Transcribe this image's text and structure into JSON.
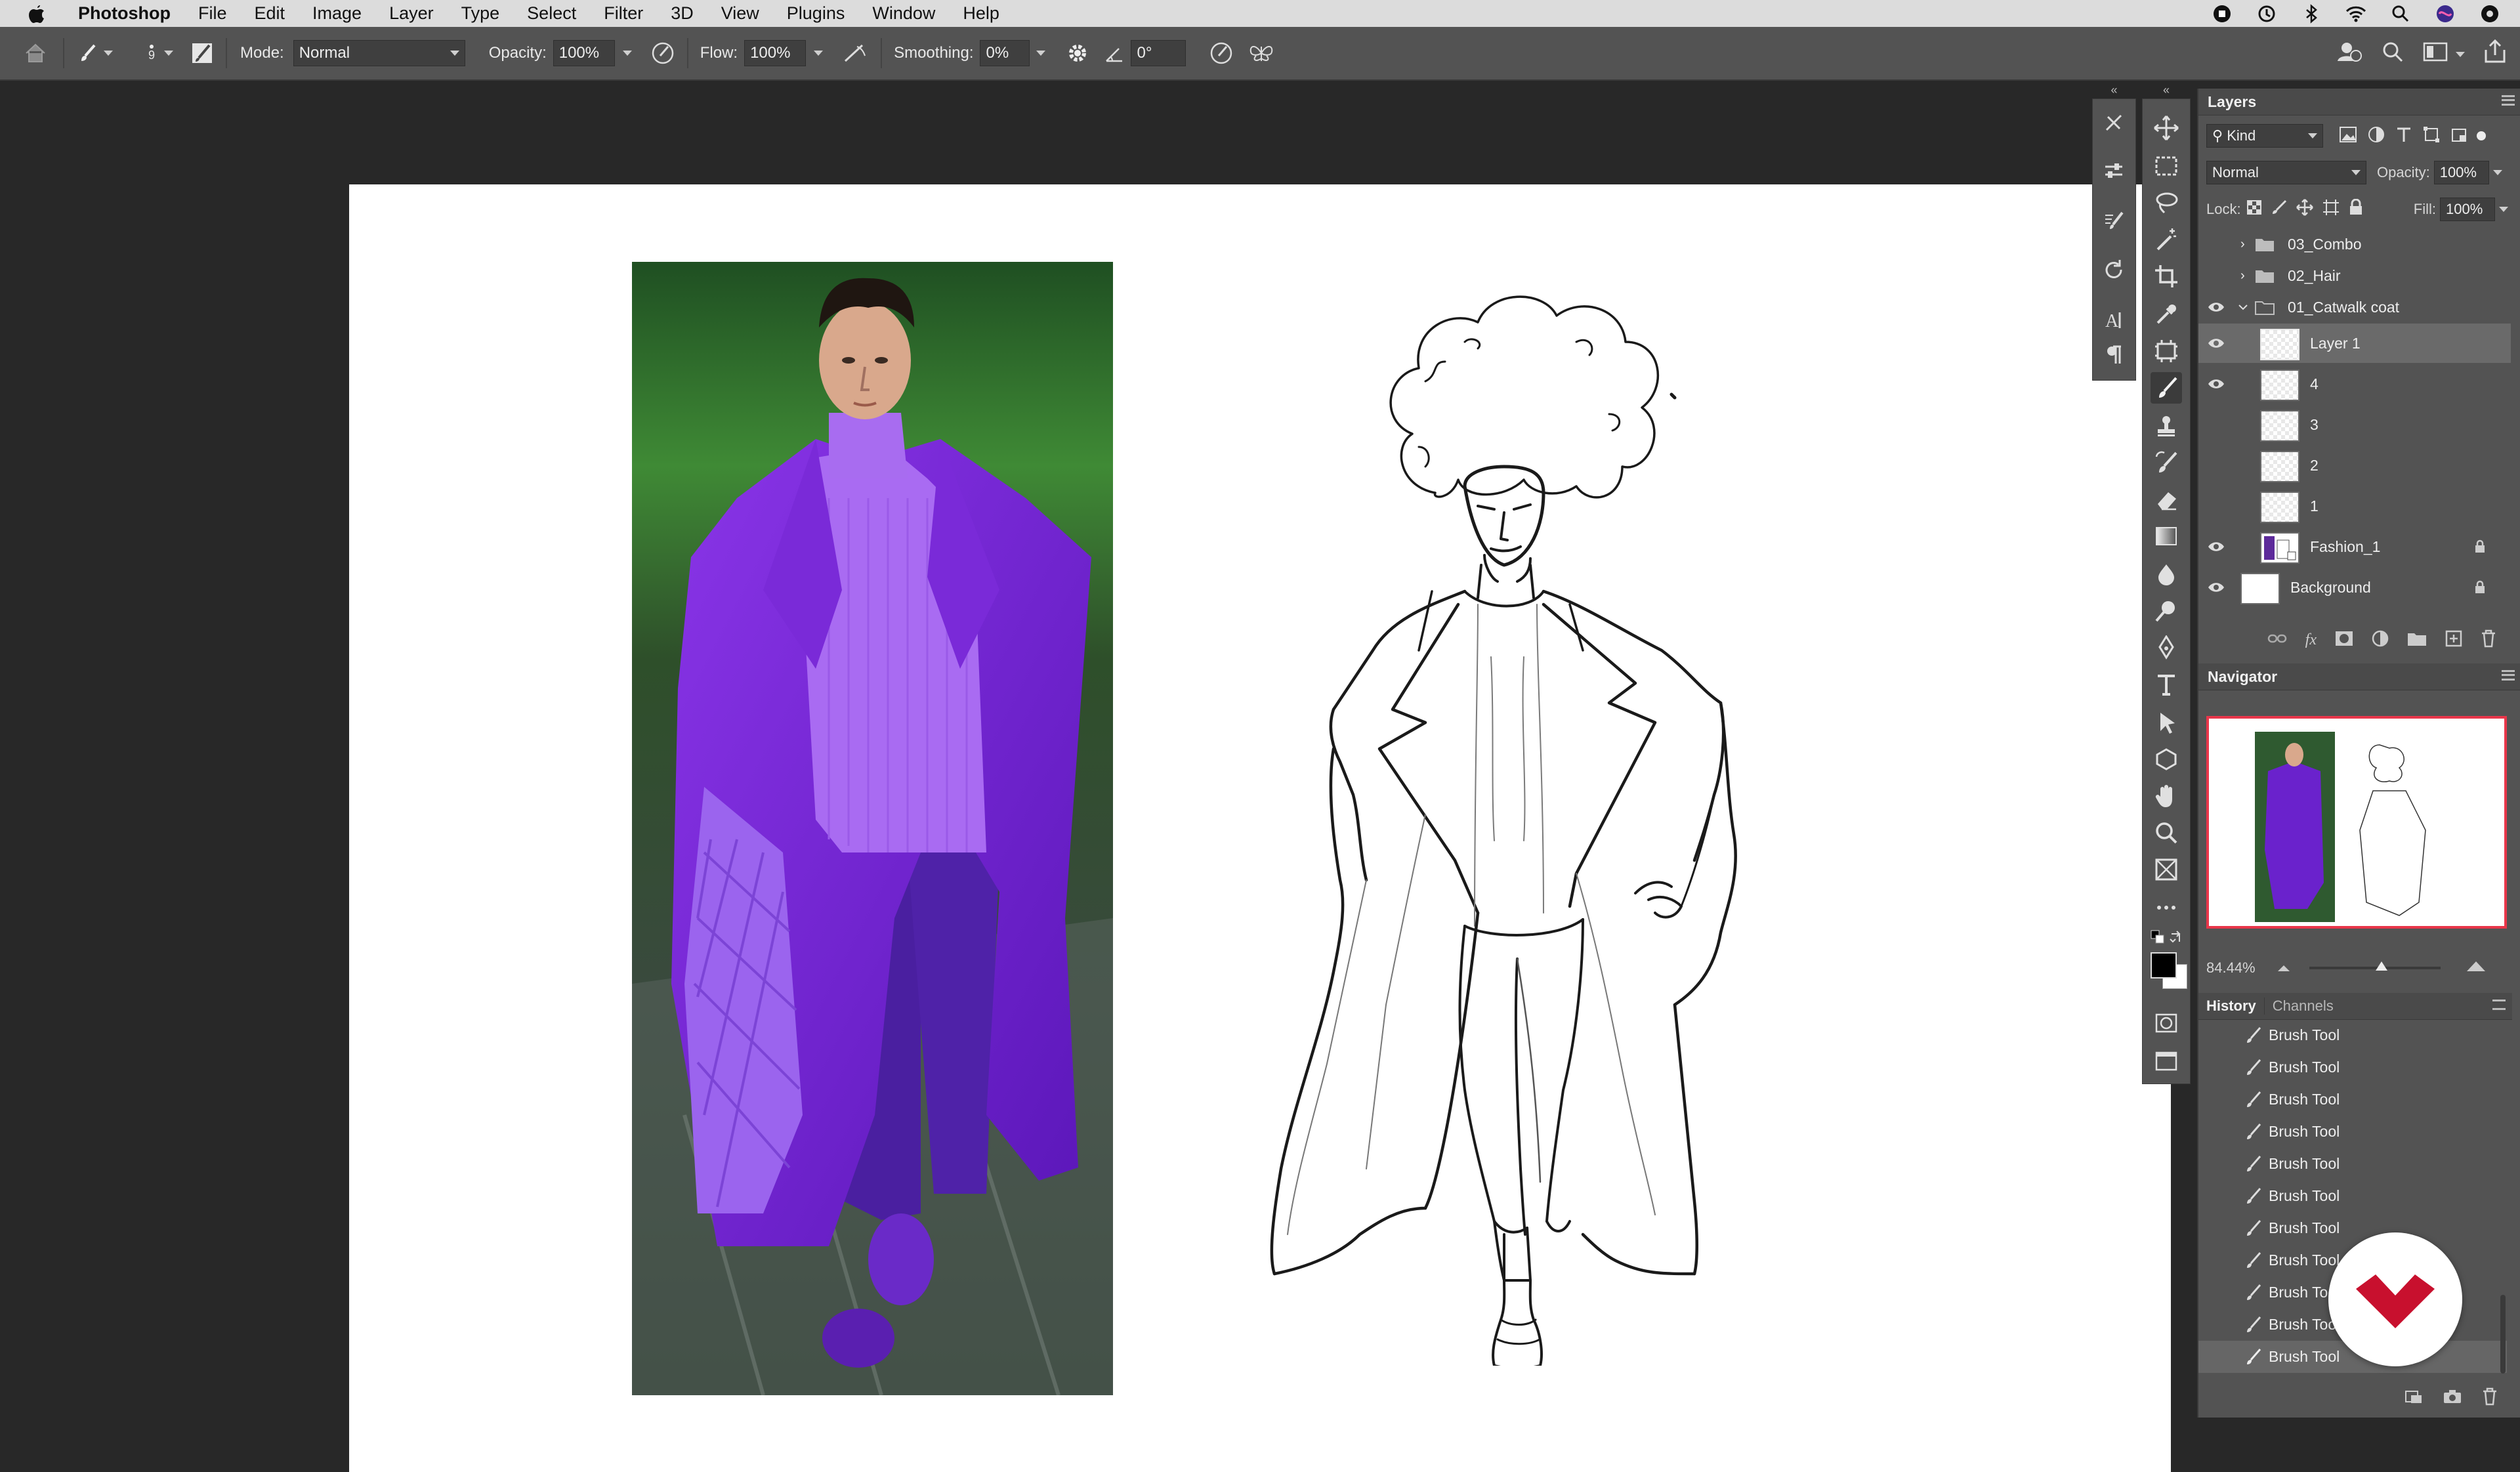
{
  "menubar": {
    "app": "Photoshop",
    "items": [
      "File",
      "Edit",
      "Image",
      "Layer",
      "Type",
      "Select",
      "Filter",
      "3D",
      "View",
      "Plugins",
      "Window",
      "Help"
    ],
    "right_icons": [
      "record-icon",
      "time-machine-icon",
      "bluetooth-icon",
      "wifi-icon",
      "search-icon",
      "siri-icon",
      "control-center-icon"
    ]
  },
  "options": {
    "brush_size": "9",
    "mode_label": "Mode:",
    "mode_value": "Normal",
    "opacity_label": "Opacity:",
    "opacity_value": "100%",
    "flow_label": "Flow:",
    "flow_value": "100%",
    "smoothing_label": "Smoothing:",
    "smoothing_value": "0%",
    "angle_value": "0°"
  },
  "layers_panel": {
    "title": "Layers",
    "kind_label": "Kind",
    "blend_mode": "Normal",
    "opacity_label": "Opacity:",
    "opacity_value": "100%",
    "lock_label": "Lock:",
    "fill_label": "Fill:",
    "fill_value": "100%",
    "items": [
      {
        "name": "03_Combo",
        "type": "group",
        "visible": false,
        "expanded": false
      },
      {
        "name": "02_Hair",
        "type": "group",
        "visible": false,
        "expanded": false
      },
      {
        "name": "01_Catwalk coat",
        "type": "group",
        "visible": true,
        "expanded": true
      },
      {
        "name": "Layer 1",
        "type": "layer",
        "visible": true,
        "selected": true
      },
      {
        "name": "4",
        "type": "layer",
        "visible": true
      },
      {
        "name": "3",
        "type": "layer",
        "visible": false
      },
      {
        "name": "2",
        "type": "layer",
        "visible": false
      },
      {
        "name": "1",
        "type": "layer",
        "visible": false
      },
      {
        "name": "Fashion_1",
        "type": "smart",
        "visible": true,
        "locked": true
      },
      {
        "name": "Background",
        "type": "background",
        "visible": true,
        "locked": true
      }
    ]
  },
  "navigator": {
    "title": "Navigator",
    "zoom": "84.44%",
    "zoom_level": 0.55
  },
  "history_panel": {
    "tabs": [
      "History",
      "Channels"
    ],
    "items": [
      "Brush Tool",
      "Brush Tool",
      "Brush Tool",
      "Brush Tool",
      "Brush Tool",
      "Brush Tool",
      "Brush Tool",
      "Brush Tool",
      "Brush Tool",
      "Brush Tool",
      "Brush Tool"
    ]
  },
  "colors": {
    "accent_purple": "#6a1fd1",
    "navigator_frame": "#e8364a",
    "badge_red": "#c8102e"
  }
}
